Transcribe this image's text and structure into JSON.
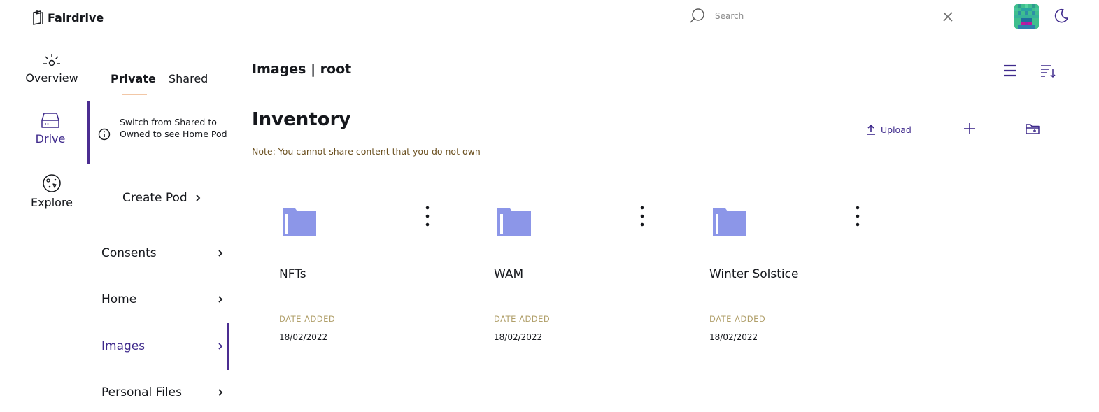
{
  "header": {
    "app_name": "Fairdrive",
    "search": {
      "placeholder": "Search",
      "value": ""
    },
    "icons": [
      "logo-icon",
      "search-icon",
      "close-icon",
      "avatar",
      "moon-icon"
    ]
  },
  "rail": {
    "items": [
      {
        "label": "Overview",
        "icon": "sun-icon",
        "active": false
      },
      {
        "label": "Drive",
        "icon": "drive-icon",
        "active": true
      },
      {
        "label": "Explore",
        "icon": "compass-icon",
        "active": false
      }
    ]
  },
  "pods_panel": {
    "tabs": [
      {
        "label": "Private",
        "active": true
      },
      {
        "label": "Shared",
        "active": false
      }
    ],
    "info_message": "Switch from Shared to Owned to see Home Pod",
    "create_pod_label": "Create Pod",
    "pods": [
      {
        "label": "Consents",
        "active": false
      },
      {
        "label": "Home",
        "active": false
      },
      {
        "label": "Images",
        "active": true
      },
      {
        "label": "Personal Files",
        "active": false
      }
    ]
  },
  "main": {
    "breadcrumb": "Images | root",
    "title": "Inventory",
    "note": "Note: You cannot share content that you do not own",
    "upload_label": "Upload",
    "items": [
      {
        "name": "NFTs",
        "date_label": "DATE ADDED",
        "date": "18/02/2022",
        "icon": "folder-icon"
      },
      {
        "name": "WAM",
        "date_label": "DATE ADDED",
        "date": "18/02/2022",
        "icon": "folder-icon"
      },
      {
        "name": "Winter Solstice",
        "date_label": "DATE ADDED",
        "date": "18/02/2022",
        "icon": "folder-icon"
      }
    ]
  },
  "colors": {
    "accent": "#3f2a8c",
    "accent_bar": "#4b2d91",
    "folder": "#8c96e8",
    "note_text": "#6b5020",
    "date_label": "#b1a06b",
    "tab_underline": "#f2c7a6"
  }
}
